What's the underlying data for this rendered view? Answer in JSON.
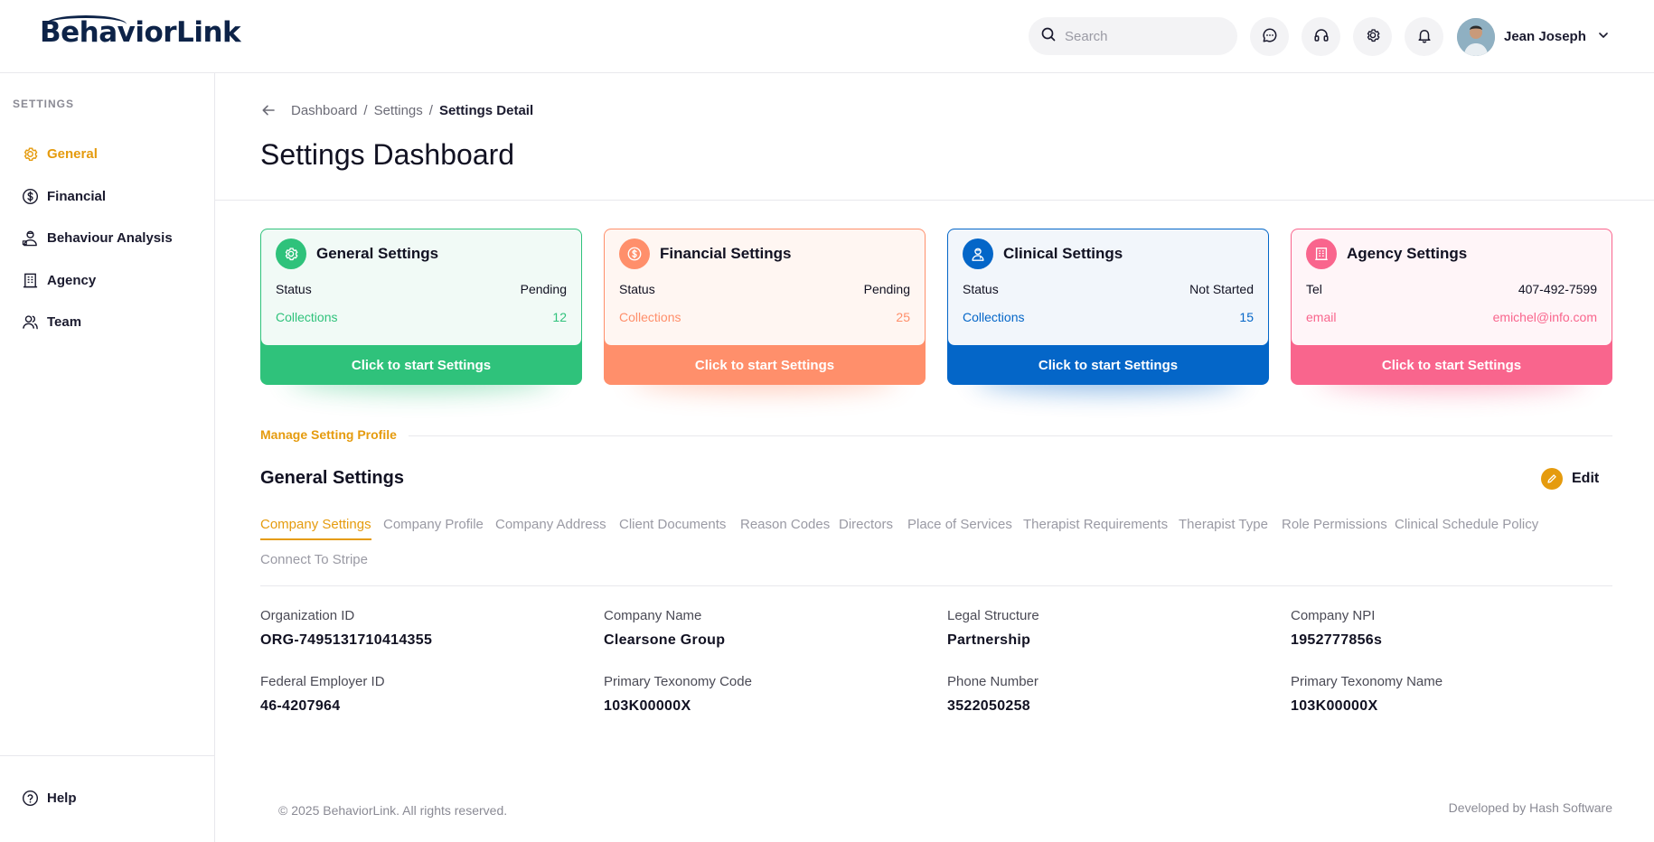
{
  "header": {
    "logo_text": "BehaviorLink",
    "search_placeholder": "Search",
    "user_name": "Jean Joseph"
  },
  "sidebar": {
    "section_title": "SETTINGS",
    "items": [
      {
        "label": "General",
        "active": true,
        "icon": "gear-icon"
      },
      {
        "label": "Financial",
        "active": false,
        "icon": "dollar-circle-icon"
      },
      {
        "label": "Behaviour Analysis",
        "active": false,
        "icon": "person-analysis-icon"
      },
      {
        "label": "Agency",
        "active": false,
        "icon": "building-icon"
      },
      {
        "label": "Team",
        "active": false,
        "icon": "team-icon"
      }
    ],
    "help_label": "Help"
  },
  "breadcrumb": [
    "Dashboard",
    "Settings",
    "Settings Detail"
  ],
  "page_title": "Settings Dashboard",
  "cards": [
    {
      "title": "General Settings",
      "row1_label": "Status",
      "row1_value": "Pending",
      "row2_label": "Collections",
      "row2_value": "12",
      "action": "Click to start Settings",
      "color": "#2fc27b",
      "tint": "#f1faf6",
      "icon": "gear-icon"
    },
    {
      "title": "Financial Settings",
      "row1_label": "Status",
      "row1_value": "Pending",
      "row2_label": "Collections",
      "row2_value": "25",
      "action": "Click to start Settings",
      "color": "#ff8f6b",
      "tint": "#fff6f2",
      "icon": "dollar-circle-icon"
    },
    {
      "title": "Clinical Settings",
      "row1_label": "Status",
      "row1_value": "Not Started",
      "row2_label": "Collections",
      "row2_value": "15",
      "action": "Click to start Settings",
      "color": "#0466c8",
      "tint": "#f2f6fb",
      "icon": "clinician-icon"
    },
    {
      "title": "Agency Settings",
      "row1_label": "Tel",
      "row1_value": "407-492-7599",
      "row2_label": "email",
      "row2_value": "emichel@info.com",
      "action": "Click to start Settings",
      "color": "#f9658d",
      "tint": "#fff5f8",
      "icon": "building-icon"
    }
  ],
  "profile": {
    "section_label": "Manage Setting Profile",
    "title": "General Settings",
    "edit_label": "Edit",
    "accent": "#e59b0e",
    "tabs": [
      "Company Settings",
      "Company Profile",
      "Company Address",
      "Client Documents",
      "Reason Codes",
      "Directors",
      "Place of Services",
      "Therapist Requirements",
      "Therapist Type",
      "Role Permissions",
      "Clinical Schedule Policy",
      "Connect To Stripe"
    ],
    "active_tab": "Company Settings",
    "fields": [
      {
        "label": "Organization ID",
        "value": "ORG-7495131710414355"
      },
      {
        "label": "Company Name",
        "value": "Clearsone Group"
      },
      {
        "label": "Legal Structure",
        "value": "Partnership"
      },
      {
        "label": "Company NPI",
        "value": "1952777856s"
      },
      {
        "label": "Federal Employer ID",
        "value": "46-4207964"
      },
      {
        "label": "Primary Texonomy Code",
        "value": "103K00000X"
      },
      {
        "label": "Phone Number",
        "value": "3522050258"
      },
      {
        "label": "Primary Texonomy Name",
        "value": "103K00000X"
      }
    ]
  },
  "footer": {
    "copyright": "© 2025 BehaviorLink. All rights reserved.",
    "credit": "Developed by Hash Software"
  }
}
